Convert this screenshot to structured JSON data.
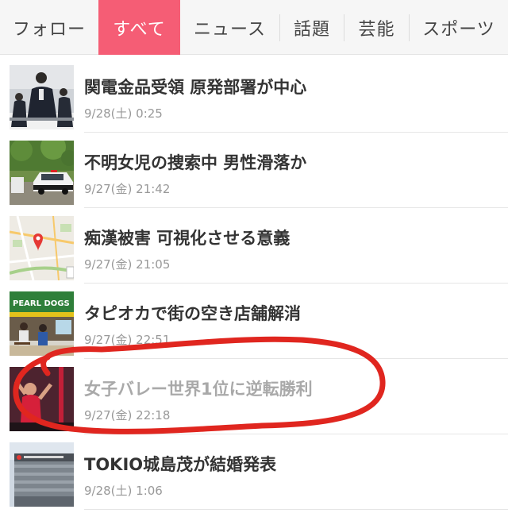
{
  "tabs": [
    {
      "label": "フォロー",
      "active": false
    },
    {
      "label": "すべて",
      "active": true
    },
    {
      "label": "ニュース",
      "active": false
    },
    {
      "label": "話題",
      "active": false
    },
    {
      "label": "芸能",
      "active": false
    },
    {
      "label": "スポーツ",
      "active": false
    }
  ],
  "news": [
    {
      "title": "関電金品受領 原発部署が中心",
      "time": "9/28(土) 0:25",
      "thumb_icon": "press-conference-photo",
      "visited": false
    },
    {
      "title": "不明女児の捜索中 男性滑落か",
      "time": "9/27(金) 21:42",
      "thumb_icon": "police-car-photo",
      "visited": false
    },
    {
      "title": "痴漢被害 可視化させる意義",
      "time": "9/27(金) 21:05",
      "thumb_icon": "map-icon",
      "visited": false
    },
    {
      "title": "タピオカで街の空き店舗解消",
      "time": "9/27(金) 22:51",
      "thumb_icon": "pearl-shop-photo",
      "visited": false
    },
    {
      "title": "女子バレー世界1位に逆転勝利",
      "time": "9/27(金) 22:18",
      "thumb_icon": "volleyball-photo",
      "visited": true
    },
    {
      "title": "TOKIO城島茂が結婚発表",
      "time": "9/28(土) 1:06",
      "thumb_icon": "building-photo",
      "visited": false
    }
  ],
  "thumb_text": {
    "pearl_sign": "PEARL DOGS"
  },
  "colors": {
    "active_tab": "#f55d75",
    "annotation": "#e0261f",
    "title": "#333333",
    "visited_title": "#a9a9a9",
    "time": "#999999"
  }
}
